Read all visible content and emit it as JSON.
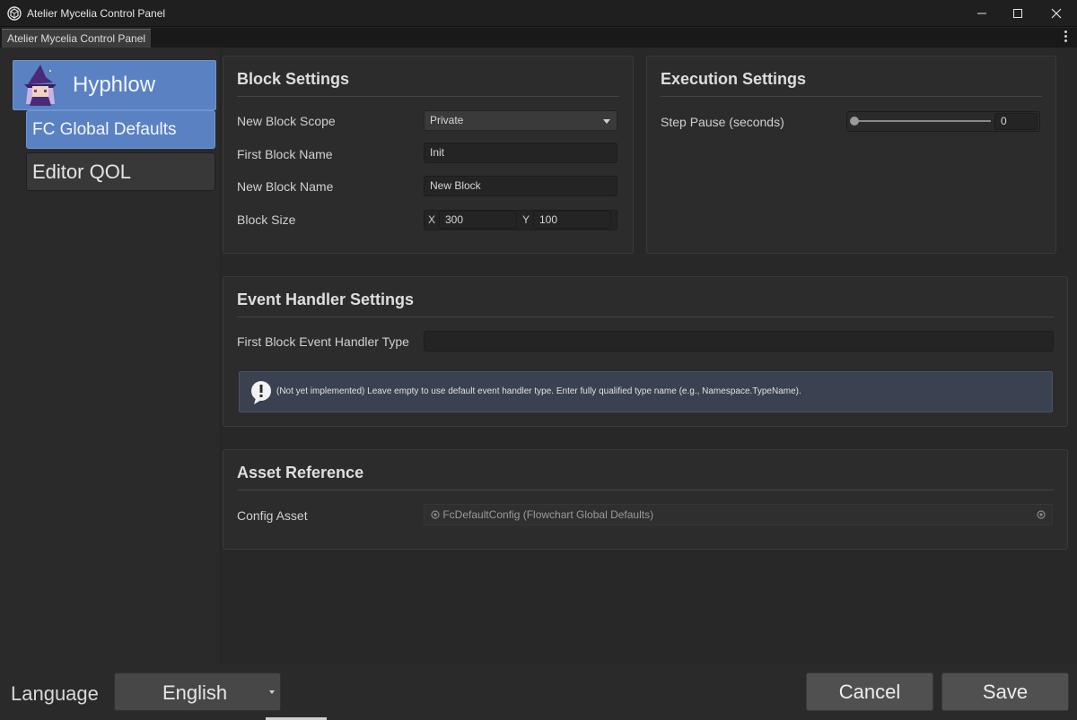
{
  "window": {
    "title": "Atelier Mycelia Control Panel"
  },
  "tab": {
    "label": "Atelier Mycelia Control Panel"
  },
  "sidebar": {
    "root_label": "Hyphlow",
    "items": [
      {
        "label": "FC Global Defaults",
        "active": true
      },
      {
        "label": "Editor QOL",
        "active": false
      }
    ]
  },
  "block_settings": {
    "title": "Block Settings",
    "scope_label": "New Block Scope",
    "scope_value": "Private",
    "first_name_label": "First Block Name",
    "first_name_value": "Init",
    "new_name_label": "New Block Name",
    "new_name_value": "New Block",
    "size_label": "Block Size",
    "size_x_label": "X",
    "size_x_value": "300",
    "size_y_label": "Y",
    "size_y_value": "100"
  },
  "execution_settings": {
    "title": "Execution Settings",
    "step_pause_label": "Step Pause (seconds)",
    "step_pause_value": "0"
  },
  "event_handler": {
    "title": "Event Handler Settings",
    "type_label": "First Block Event Handler Type",
    "type_value": "",
    "info": "(Not yet implemented) Leave empty to use default event handler type. Enter fully qualified type name (e.g., Namespace.TypeName)."
  },
  "asset_reference": {
    "title": "Asset Reference",
    "config_label": "Config Asset",
    "config_value": "FcDefaultConfig (Flowchart Global Defaults)"
  },
  "footer": {
    "language_label": "Language",
    "language_value": "English",
    "cancel_label": "Cancel",
    "save_label": "Save"
  },
  "colors": {
    "accent": "#5a82c3",
    "background": "#282828",
    "panel": "#2c2c2c",
    "info_bg": "#3a4150"
  },
  "icons": [
    "unity-logo-icon",
    "minimize-icon",
    "maximize-icon",
    "close-icon",
    "kebab-menu-icon",
    "wizard-avatar-icon",
    "warning-icon",
    "object-asset-icon",
    "object-picker-icon",
    "chevron-down-icon"
  ]
}
